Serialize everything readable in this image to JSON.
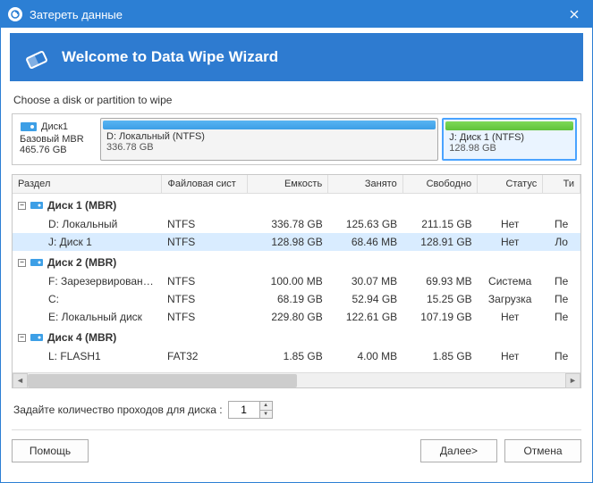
{
  "window": {
    "title": "Затереть данные"
  },
  "header": {
    "title": "Welcome to Data Wipe Wizard"
  },
  "instruction": "Choose a disk or partition to wipe",
  "diskbar": {
    "disk": {
      "name": "Диск1",
      "type": "Базовый MBR",
      "size": "465.76 GB"
    },
    "parts": [
      {
        "label": "D: Локальный (NTFS)",
        "size": "336.78 GB",
        "color": "blue",
        "selected": false,
        "flex": 3
      },
      {
        "label": "J: Диск 1 (NTFS)",
        "size": "128.98 GB",
        "color": "green",
        "selected": true,
        "flex": 1.15
      }
    ]
  },
  "columns": {
    "partition": "Раздел",
    "fs": "Файловая сист",
    "capacity": "Емкость",
    "used": "Занято",
    "free": "Свободно",
    "status": "Статус",
    "type": "Ти"
  },
  "rows": [
    {
      "kind": "disk",
      "label": "Диск 1 (MBR)"
    },
    {
      "kind": "part",
      "label": "D: Локальный",
      "fs": "NTFS",
      "cap": "336.78 GB",
      "used": "125.63 GB",
      "free": "211.15 GB",
      "status": "Нет",
      "type": "Пе"
    },
    {
      "kind": "part",
      "label": "J: Диск 1",
      "fs": "NTFS",
      "cap": "128.98 GB",
      "used": "68.46 MB",
      "free": "128.91 GB",
      "status": "Нет",
      "type": "Ло",
      "selected": true
    },
    {
      "kind": "disk",
      "label": "Диск 2 (MBR)"
    },
    {
      "kind": "part",
      "label": "F: Зарезервировано си…",
      "fs": "NTFS",
      "cap": "100.00 MB",
      "used": "30.07 MB",
      "free": "69.93 MB",
      "status": "Система",
      "type": "Пе"
    },
    {
      "kind": "part",
      "label": "C:",
      "fs": "NTFS",
      "cap": "68.19 GB",
      "used": "52.94 GB",
      "free": "15.25 GB",
      "status": "Загрузка",
      "type": "Пе"
    },
    {
      "kind": "part",
      "label": "E: Локальный диск",
      "fs": "NTFS",
      "cap": "229.80 GB",
      "used": "122.61 GB",
      "free": "107.19 GB",
      "status": "Нет",
      "type": "Пе"
    },
    {
      "kind": "disk",
      "label": "Диск 4 (MBR)"
    },
    {
      "kind": "part",
      "label": "L: FLASH1",
      "fs": "FAT32",
      "cap": "1.85 GB",
      "used": "4.00 MB",
      "free": "1.85 GB",
      "status": "Нет",
      "type": "Пе"
    }
  ],
  "passes": {
    "label": "Задайте количество проходов для диска :",
    "value": "1"
  },
  "buttons": {
    "help": "Помощь",
    "next": "Далее>",
    "cancel": "Отмена"
  }
}
